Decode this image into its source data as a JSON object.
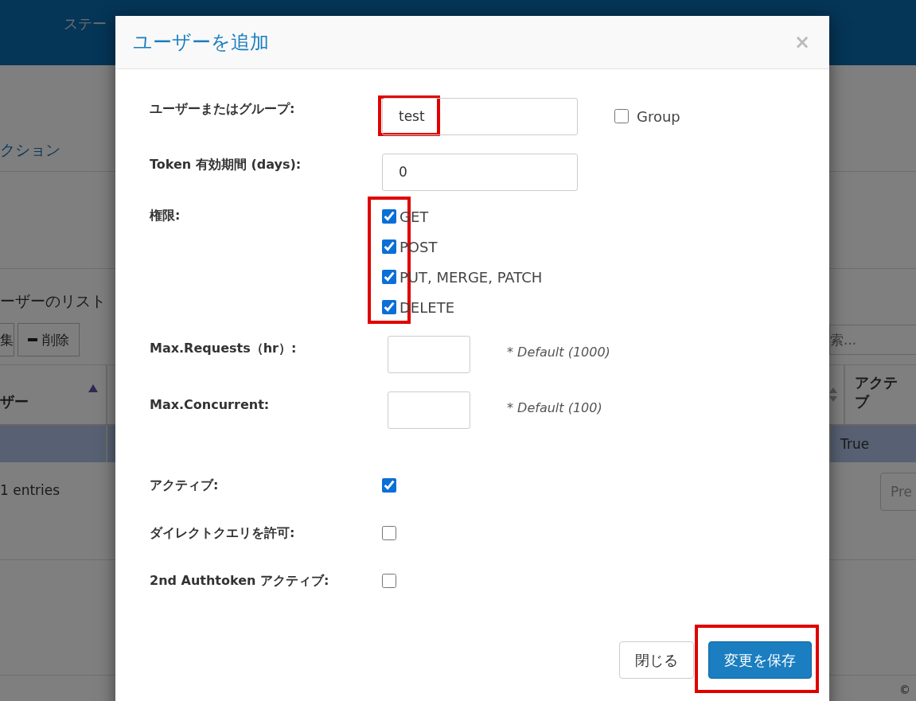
{
  "background": {
    "header_tab": "ステー",
    "nav_link": "クション",
    "list_caption": "ーザーのリスト",
    "toolbar_buttons": [
      {
        "label": "集",
        "kind": "text"
      },
      {
        "label": "削除",
        "kind": "remove"
      }
    ],
    "search": {
      "placeholder": "索..."
    },
    "table": {
      "columns": [
        {
          "label": "ザー"
        },
        {
          "label": "アクテブ"
        }
      ],
      "rows": [
        {
          "selected": true,
          "cells": [
            "True"
          ]
        }
      ]
    },
    "entries_info": "1 entries",
    "pager_button": "Pre",
    "footer": "©"
  },
  "dialog": {
    "title": "ユーザーを追加",
    "close": "×",
    "fields": [
      {
        "kind": "text",
        "label": "ユーザーまたはグループ:",
        "value": "test",
        "highlighted": true,
        "extra": {
          "label": "Group",
          "checked": false
        }
      },
      {
        "kind": "text",
        "label": "Token 有効期間 (days):",
        "value": "0"
      },
      {
        "kind": "checklist",
        "label": "権限:",
        "highlighted": true,
        "options": [
          {
            "label": "GET",
            "checked": true
          },
          {
            "label": "POST",
            "checked": true
          },
          {
            "label": "PUT, MERGE, PATCH",
            "checked": true
          },
          {
            "label": "DELETE",
            "checked": true
          }
        ]
      },
      {
        "kind": "number",
        "label": "Max.Requests（hr）:",
        "hint": "* Default (1000)"
      },
      {
        "kind": "number",
        "label": "Max.Concurrent:",
        "hint": "* Default (100)"
      },
      {
        "kind": "checkbox",
        "label": "アクティブ:",
        "checked": true
      },
      {
        "kind": "checkbox",
        "label": "ダイレクトクエリを許可:",
        "checked": false
      },
      {
        "kind": "checkbox",
        "label": "2nd Authtoken アクティブ:",
        "checked": false
      }
    ],
    "buttons": [
      {
        "label": "閉じる",
        "kind": "secondary"
      },
      {
        "label": "変更を保存",
        "kind": "primary",
        "highlighted": true
      }
    ]
  }
}
